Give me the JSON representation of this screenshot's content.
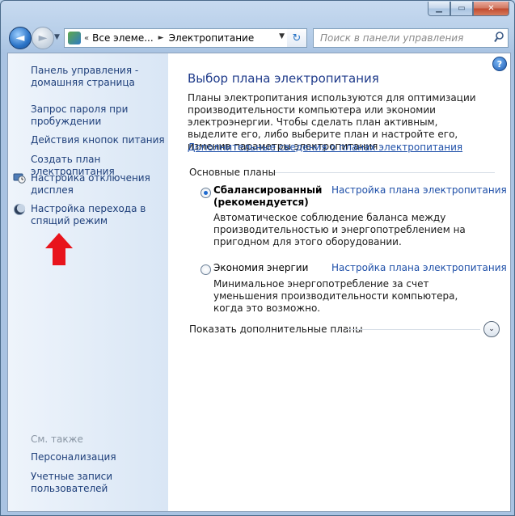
{
  "window": {
    "minimize_symbol": "▁",
    "maximize_symbol": "▭",
    "close_symbol": "✕"
  },
  "nav": {
    "back_symbol": "◄",
    "forward_symbol": "►",
    "recent_symbol": "▼",
    "address": {
      "chevron": "«",
      "crumbs": [
        "Все элеме...",
        "Электропитание"
      ],
      "separator": "►",
      "dropdown_symbol": "▼"
    },
    "refresh_symbol": "↻",
    "search_placeholder": "Поиск в панели управления"
  },
  "sidebar": {
    "home_link": "Панель управления - домашняя страница",
    "items": [
      {
        "label": "Запрос пароля при пробуждении",
        "icon": null
      },
      {
        "label": "Действия кнопок питания",
        "icon": null
      },
      {
        "label": "Создать план электропитания",
        "icon": null
      },
      {
        "label": "Настройка отключения дисплея",
        "icon": "display-clock-icon"
      },
      {
        "label": "Настройка перехода в спящий режим",
        "icon": "moon-icon"
      }
    ],
    "see_also": {
      "title": "См. также",
      "links": [
        "Персонализация",
        "Учетные записи пользователей"
      ]
    }
  },
  "main": {
    "help_symbol": "?",
    "title": "Выбор плана электропитания",
    "description": "Планы электропитания используются для оптимизации производительности компьютера или экономии электроэнергии. Чтобы сделать план активным, выделите его, либо выберите план и настройте его, изменив параметры электропитания",
    "more_link": "Дополнительные сведения о планах электропитания",
    "group_label": "Основные планы",
    "plans": [
      {
        "name": "Сбалансированный (рекомендуется)",
        "selected": true,
        "settings_link": "Настройка плана электропитания",
        "description": "Автоматическое соблюдение баланса между производительностью и энергопотреблением на пригодном для этого оборудовании."
      },
      {
        "name": "Экономия энергии",
        "selected": false,
        "settings_link": "Настройка плана электропитания",
        "description": "Минимальное энергопотребление за счет уменьшения производительности компьютера, когда это возможно."
      }
    ],
    "show_more": "Показать дополнительные планы",
    "expand_symbol": "⌄"
  },
  "colors": {
    "link": "#1e4fa8",
    "title": "#1e3a8a",
    "annotation_arrow": "#e8141c"
  }
}
